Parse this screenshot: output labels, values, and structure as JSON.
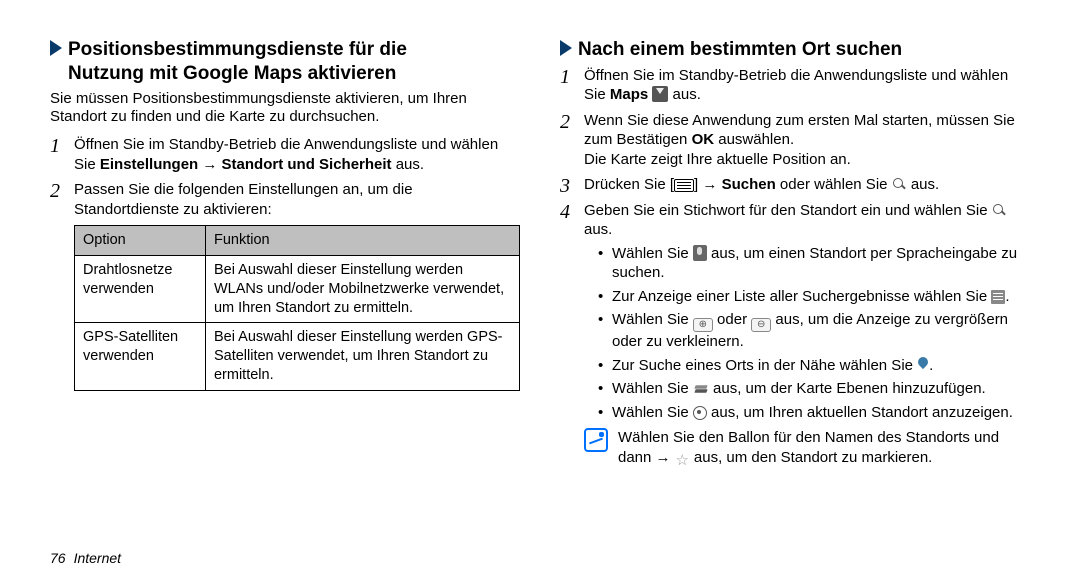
{
  "left": {
    "heading_line1": "Positionsbestimmungsdienste für die",
    "heading_line2": "Nutzung mit Google Maps aktivieren",
    "intro": "Sie müssen Positionsbestimmungsdienste aktivieren, um Ihren Standort zu finden und die Karte zu durchsuchen.",
    "step1_pre": "Öffnen Sie im Standby-Betrieb die Anwendungsliste und wählen Sie ",
    "step1_bold": "Einstellungen → Standort und Sicherheit",
    "step1_post": " aus.",
    "step2": "Passen Sie die folgenden Einstellungen an, um die Standortdienste zu aktivieren:",
    "table": {
      "h1": "Option",
      "h2": "Funktion",
      "r1c1": "Drahtlosnetze verwenden",
      "r1c2": "Bei Auswahl dieser Einstellung werden WLANs und/oder Mobilnetzwerke verwendet, um Ihren Standort zu ermitteln.",
      "r2c1": "GPS-Satelliten verwenden",
      "r2c2": "Bei Auswahl dieser Einstellung werden GPS-Satelliten verwendet, um Ihren Standort zu ermitteln."
    }
  },
  "right": {
    "heading": "Nach einem bestimmten Ort suchen",
    "step1_pre": "Öffnen Sie im Standby-Betrieb die Anwendungsliste und wählen Sie ",
    "step1_bold": "Maps",
    "step1_post": " aus.",
    "step2_pre": "Wenn Sie diese Anwendung zum ersten Mal starten, müssen Sie zum Bestätigen ",
    "step2_bold": "OK",
    "step2_post": " auswählen.",
    "step2_extra": "Die Karte zeigt Ihre aktuelle Position an.",
    "step3_pre": "Drücken Sie [",
    "step3_mid": "] → ",
    "step3_bold": "Suchen",
    "step3_post": " oder wählen Sie ",
    "step3_end": " aus.",
    "step4_pre": "Geben Sie ein Stichwort für den Standort ein und wählen Sie ",
    "step4_post": " aus.",
    "b1_pre": "Wählen Sie ",
    "b1_post": " aus, um einen Standort per Spracheingabe zu suchen.",
    "b2_pre": "Zur Anzeige einer Liste aller Suchergebnisse wählen Sie ",
    "b2_post": ".",
    "b3_pre": "Wählen Sie ",
    "b3_mid": " oder ",
    "b3_post": " aus, um die Anzeige zu vergrößern oder zu verkleinern.",
    "b4_pre": "Zur Suche eines Orts in der Nähe wählen Sie ",
    "b4_post": ".",
    "b5_pre": "Wählen Sie ",
    "b5_post": " aus, um der Karte Ebenen hinzuzufügen.",
    "b6_pre": "Wählen Sie ",
    "b6_post": " aus, um Ihren aktuellen Standort anzuzeigen.",
    "note_pre": "Wählen Sie den Ballon für den Namen des Standorts und dann → ",
    "note_post": " aus, um den Standort zu markieren."
  },
  "footer": {
    "page": "76",
    "section": "Internet"
  }
}
